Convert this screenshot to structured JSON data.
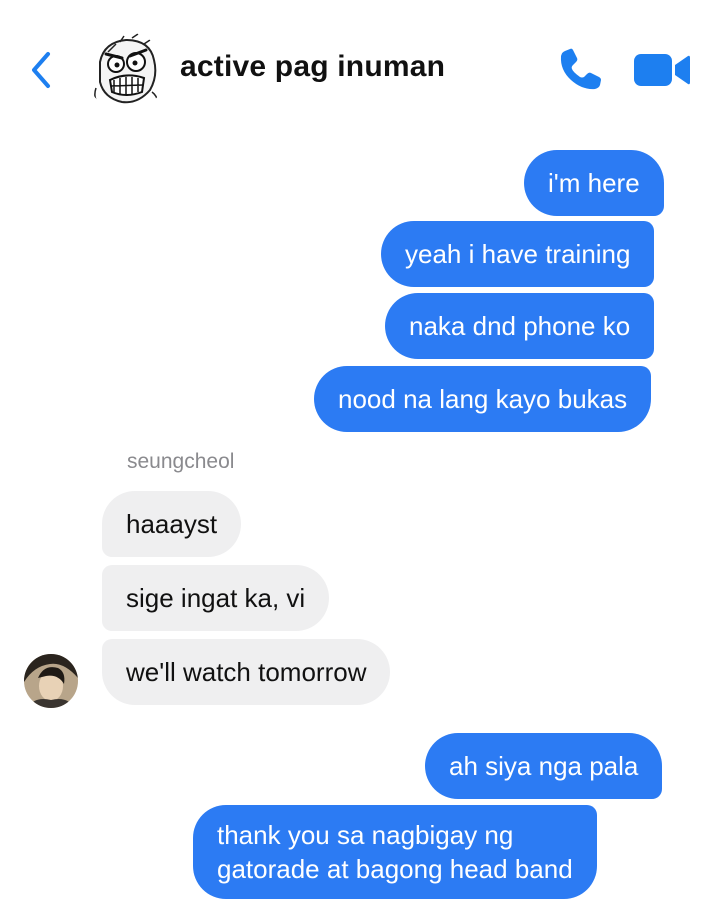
{
  "header": {
    "back_icon": "chevron-left-icon",
    "group_avatar_icon": "rage-face-avatar",
    "title": "active pag inuman",
    "call_icon": "phone-icon",
    "video_icon": "video-camera-icon",
    "accent_color": "#1d7ff0"
  },
  "messages": [
    {
      "direction": "outgoing",
      "text": "i'm here"
    },
    {
      "direction": "outgoing",
      "text": "yeah i have training"
    },
    {
      "direction": "outgoing",
      "text": "naka dnd phone ko"
    },
    {
      "direction": "outgoing",
      "text": "nood na lang kayo bukas"
    },
    {
      "direction": "incoming",
      "sender": "seungcheol",
      "text": "haaayst"
    },
    {
      "direction": "incoming",
      "text": "sige ingat ka, vi"
    },
    {
      "direction": "incoming",
      "text": "we'll watch tomorrow"
    },
    {
      "direction": "outgoing",
      "text": "ah siya nga pala"
    },
    {
      "direction": "outgoing",
      "lines": [
        "thank you sa nagbigay ng",
        "gatorade at bagong head band"
      ]
    }
  ],
  "colors": {
    "outgoing_bubble": "#2c7bf3",
    "incoming_bubble": "#efeff0",
    "sender_name": "#8a8a8e"
  }
}
